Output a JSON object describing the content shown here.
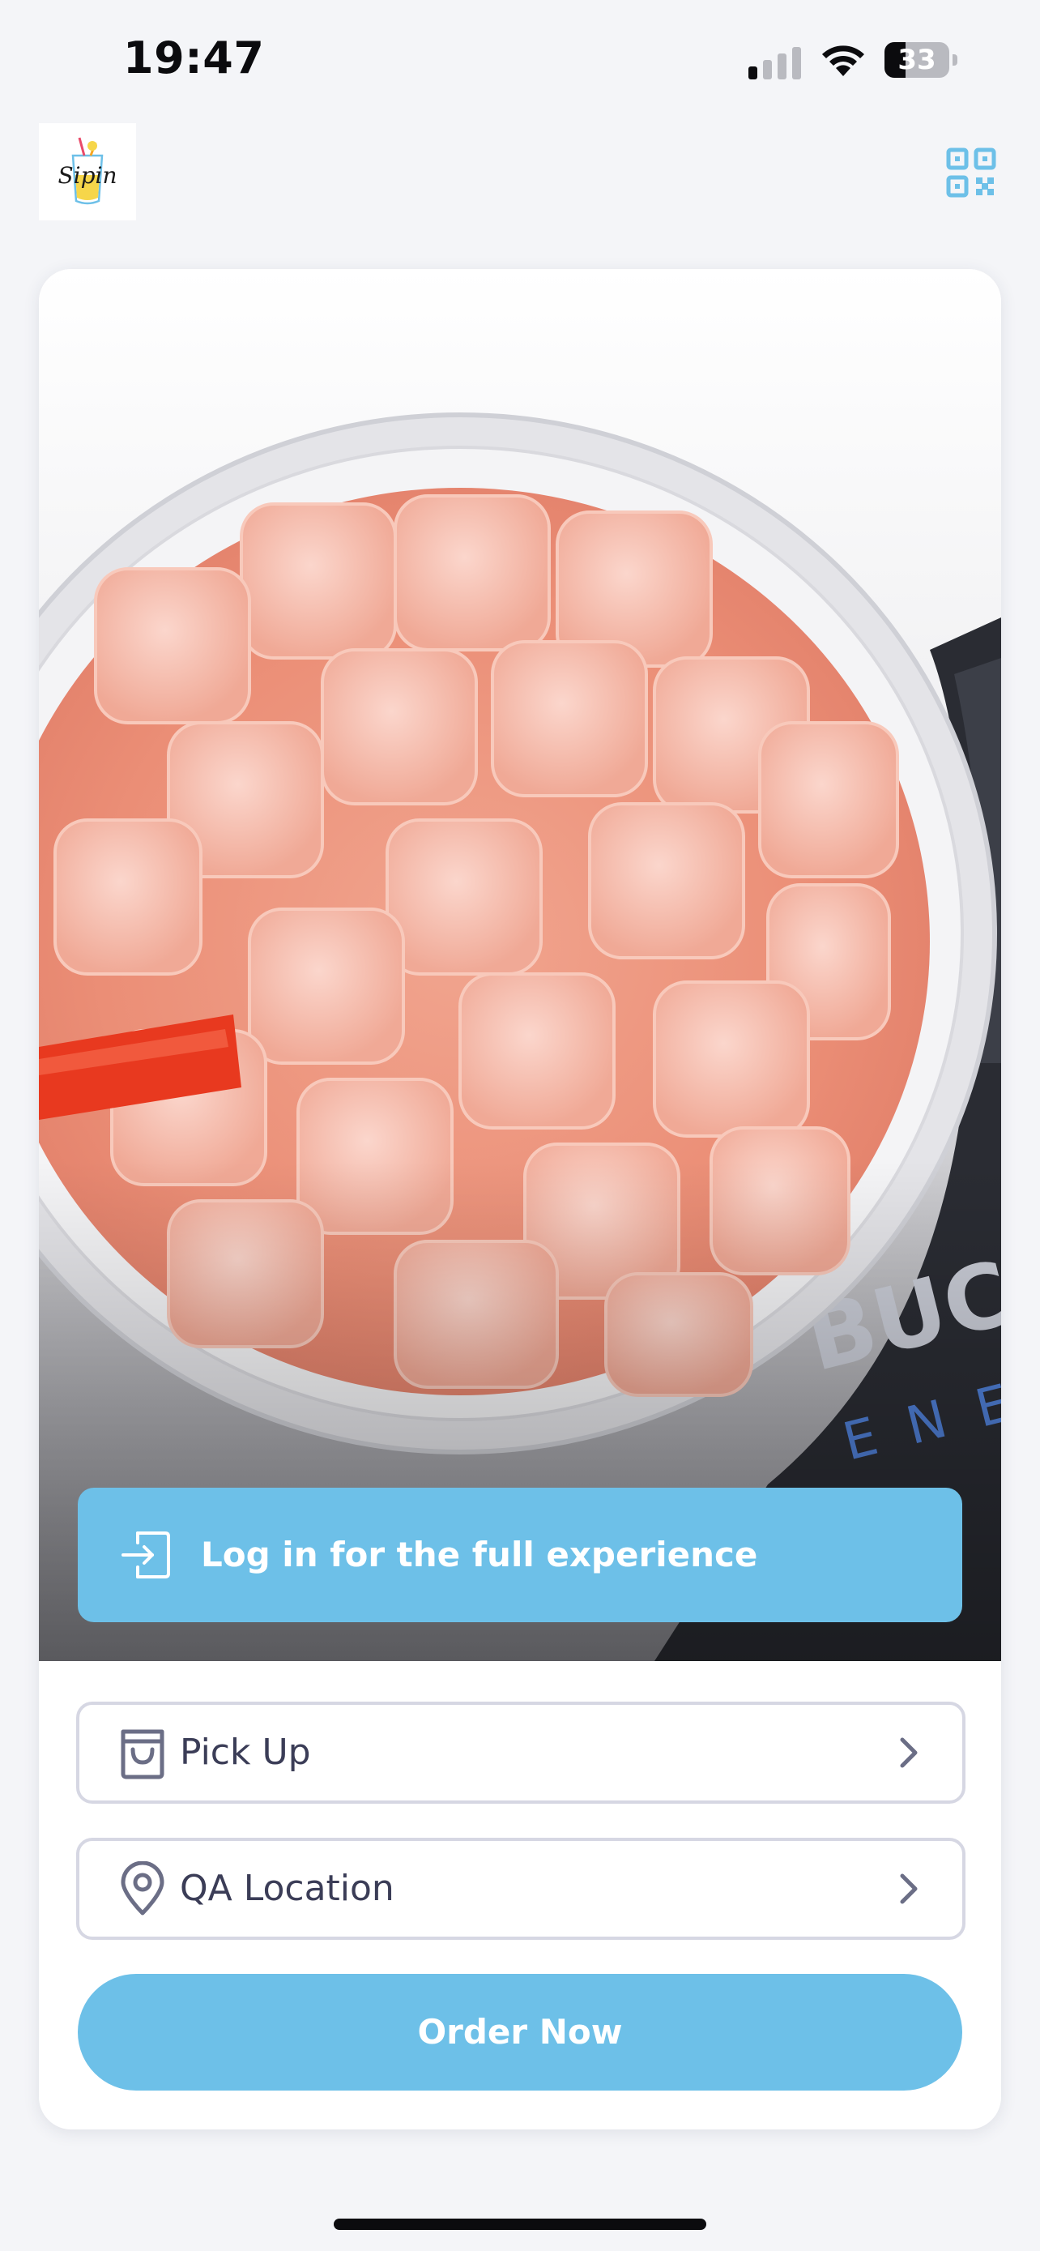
{
  "status_bar": {
    "time": "19:47",
    "battery_level": "33",
    "battery_fraction": 0.33,
    "icons": [
      "signal-icon",
      "wifi-icon",
      "battery-icon"
    ]
  },
  "header": {
    "logo_text": "Sipin",
    "qr_icon": "qr-code-icon"
  },
  "hero": {
    "image_subject": "iced-drink-photo",
    "can_lettering": "BUCK ENE",
    "login_banner": {
      "icon": "login-icon",
      "label": "Log in for the full experience"
    }
  },
  "options": {
    "pickup": {
      "icon": "shopping-bag-icon",
      "label": "Pick Up"
    },
    "location": {
      "icon": "location-pin-icon",
      "label": "QA Location"
    }
  },
  "actions": {
    "order_label": "Order Now"
  },
  "colors": {
    "accent": "#6dc0e8",
    "background": "#f4f5f8",
    "text": "#3b3d57",
    "border": "#d6d7e3"
  }
}
